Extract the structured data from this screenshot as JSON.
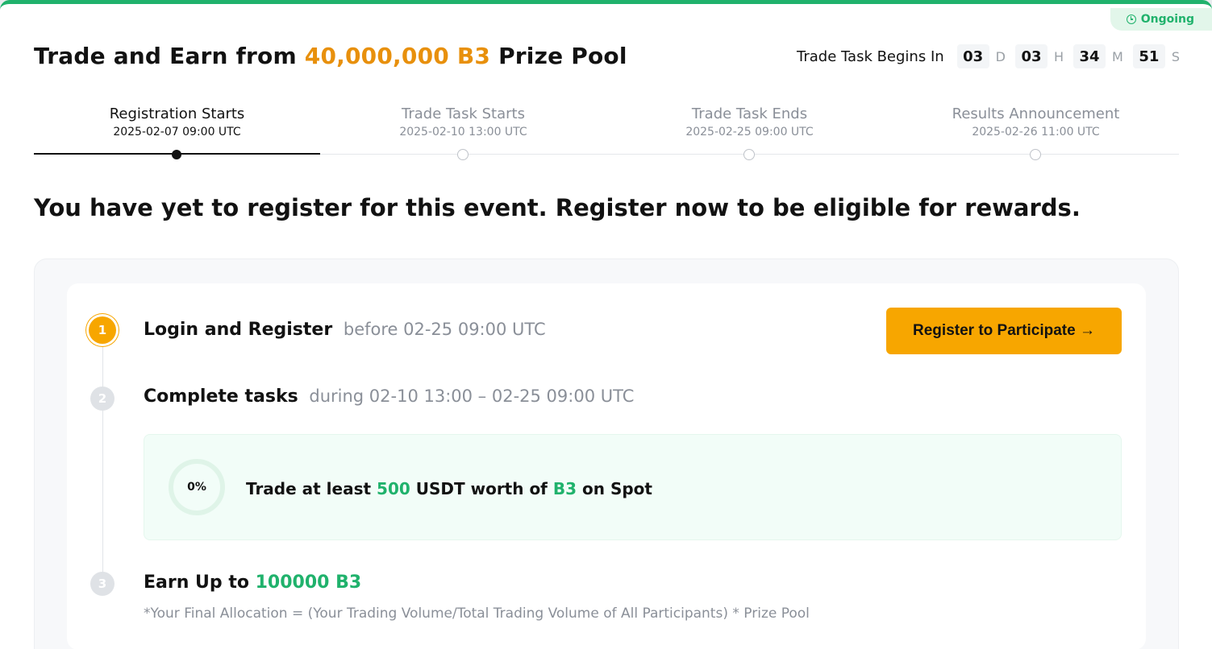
{
  "status": {
    "label": "Ongoing"
  },
  "header": {
    "title_prefix": "Trade and Earn from",
    "title_amount": "40,000,000 B3",
    "title_suffix": "Prize Pool"
  },
  "countdown": {
    "label": "Trade Task Begins In",
    "days": "03",
    "days_unit": "D",
    "hours": "03",
    "hours_unit": "H",
    "minutes": "34",
    "minutes_unit": "M",
    "seconds": "51",
    "seconds_unit": "S"
  },
  "timeline": {
    "active_index": 0,
    "steps": [
      {
        "name": "Registration Starts",
        "date": "2025-02-07 09:00 UTC"
      },
      {
        "name": "Trade Task Starts",
        "date": "2025-02-10 13:00 UTC"
      },
      {
        "name": "Trade Task Ends",
        "date": "2025-02-25 09:00 UTC"
      },
      {
        "name": "Results Announcement",
        "date": "2025-02-26 11:00 UTC"
      }
    ]
  },
  "headline": "You have yet to register for this event. Register now to be eligible for rewards.",
  "steps": {
    "step1": {
      "number": "1",
      "title": "Login and Register",
      "subtitle": "before 02-25 09:00 UTC",
      "button": "Register to Participate →"
    },
    "step2": {
      "number": "2",
      "title": "Complete tasks",
      "subtitle": "during 02-10 13:00 – 02-25 09:00 UTC",
      "task": {
        "progress": "0%",
        "text_a": "Trade at least",
        "amount": "500",
        "text_b": "USDT worth of",
        "token": "B3",
        "text_c": "on Spot"
      }
    },
    "step3": {
      "number": "3",
      "title": "Earn Up to",
      "reward": "100000 B3",
      "formula": "*Your Final Allocation = (Your Trading Volume/Total Trading Volume of All Participants) * Prize Pool"
    }
  },
  "colors": {
    "accent": "#f7a600",
    "green": "#20b26c",
    "title_amount": "#e8900c"
  }
}
